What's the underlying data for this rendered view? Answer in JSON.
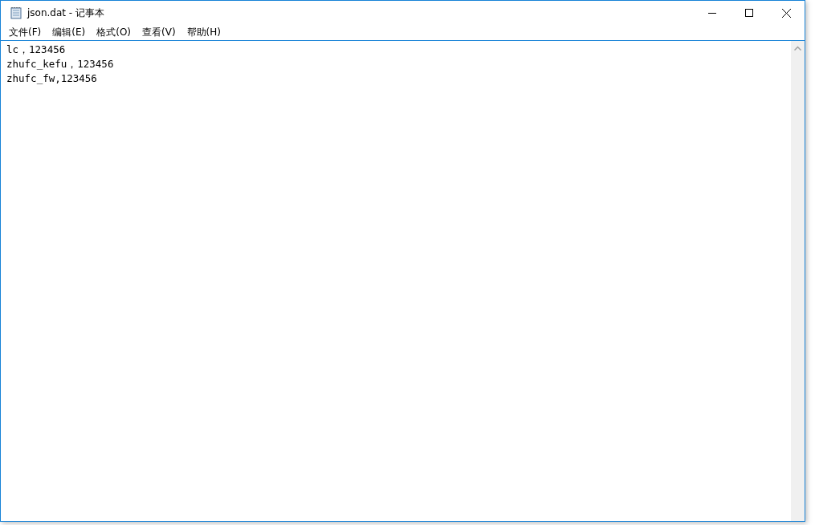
{
  "window": {
    "title": "json.dat - 记事本"
  },
  "menu": [
    {
      "label": "文件(F)"
    },
    {
      "label": "编辑(E)"
    },
    {
      "label": "格式(O)"
    },
    {
      "label": "查看(V)"
    },
    {
      "label": "帮助(H)"
    }
  ],
  "editor": {
    "lines": [
      "lc，123456",
      "zhufc_kefu，123456",
      "zhufc_fw,123456"
    ]
  }
}
